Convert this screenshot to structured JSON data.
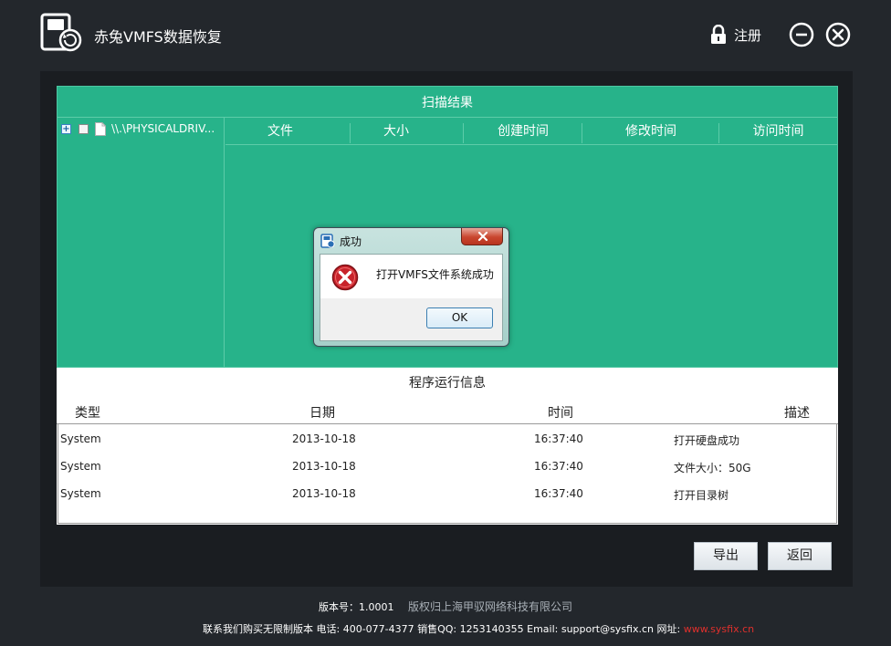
{
  "app": {
    "title": "赤兔VMFS数据恢复",
    "register_label": "注册"
  },
  "scan": {
    "header": "扫描结果",
    "tree_item": "\\\\.\\PHYSICALDRIV...",
    "columns": [
      "文件",
      "大小",
      "创建时间",
      "修改时间",
      "访问时间"
    ]
  },
  "log": {
    "title": "程序运行信息",
    "columns": [
      "类型",
      "日期",
      "时间",
      "描述"
    ],
    "rows": [
      {
        "type": "System",
        "date": "2013-10-18",
        "time": "16:37:40",
        "desc": "打开硬盘成功"
      },
      {
        "type": "System",
        "date": "2013-10-18",
        "time": "16:37:40",
        "desc": "文件大小：50G"
      },
      {
        "type": "System",
        "date": "2013-10-18",
        "time": "16:37:40",
        "desc": "打开目录树"
      }
    ]
  },
  "buttons": {
    "export": "导出",
    "back": "返回"
  },
  "footer": {
    "version": "版本号：1.0001",
    "copyright": "版权归上海甲驭网络科技有限公司",
    "contact": "联系我们购买无限制版本  电话: 400-077-4377 销售QQ: 1253140355 Email: support@sysfix.cn 网址:",
    "website": "www.sysfix.cn"
  },
  "dialog": {
    "title": "成功",
    "message": "打开VMFS文件系统成功",
    "ok_label": "OK"
  },
  "colors": {
    "accent_green": "#27b38a",
    "background": "#23272c",
    "error_red": "#c8232b",
    "link_red": "#e0302c"
  }
}
